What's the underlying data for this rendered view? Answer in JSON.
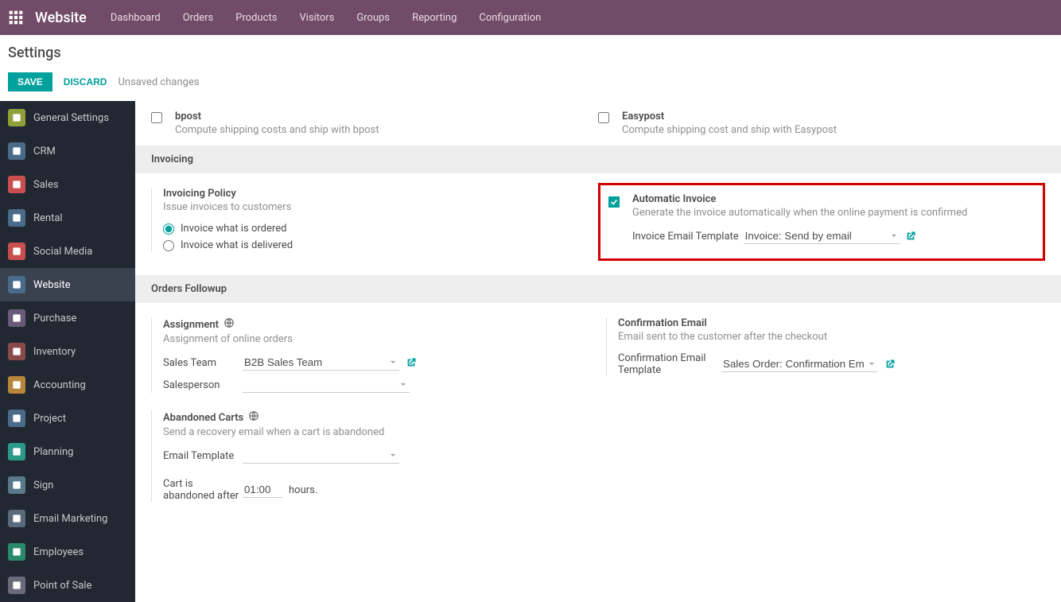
{
  "nav": {
    "brand": "Website",
    "items": [
      "Dashboard",
      "Orders",
      "Products",
      "Visitors",
      "Groups",
      "Reporting",
      "Configuration"
    ]
  },
  "page": {
    "title": "Settings",
    "save": "SAVE",
    "discard": "DISCARD",
    "unsaved": "Unsaved changes"
  },
  "sidebar": {
    "items": [
      {
        "label": "General Settings",
        "color": "#8fa03a"
      },
      {
        "label": "CRM",
        "color": "#4a6b8a"
      },
      {
        "label": "Sales",
        "color": "#c94f4f"
      },
      {
        "label": "Rental",
        "color": "#4a6b8a"
      },
      {
        "label": "Social Media",
        "color": "#c94f4f"
      },
      {
        "label": "Website",
        "color": "#4a6b8a",
        "active": true
      },
      {
        "label": "Purchase",
        "color": "#6b5b7b"
      },
      {
        "label": "Inventory",
        "color": "#8a4a4a"
      },
      {
        "label": "Accounting",
        "color": "#b8863a"
      },
      {
        "label": "Project",
        "color": "#4a6b8a"
      },
      {
        "label": "Planning",
        "color": "#2a9a8a"
      },
      {
        "label": "Sign",
        "color": "#5a7a8a"
      },
      {
        "label": "Email Marketing",
        "color": "#5a6a7a"
      },
      {
        "label": "Employees",
        "color": "#2a8a6a"
      },
      {
        "label": "Point of Sale",
        "color": "#6a6a7a"
      }
    ]
  },
  "shipping": {
    "bpost": {
      "title": "bpost",
      "desc": "Compute shipping costs and ship with bpost"
    },
    "easypost": {
      "title": "Easypost",
      "desc": "Compute shipping cost and ship with Easypost"
    }
  },
  "invoicing": {
    "section": "Invoicing",
    "policy": {
      "title": "Invoicing Policy",
      "desc": "Issue invoices to customers",
      "opt1": "Invoice what is ordered",
      "opt2": "Invoice what is delivered"
    },
    "auto": {
      "title": "Automatic Invoice",
      "desc": "Generate the invoice automatically when the online payment is confirmed",
      "template_label": "Invoice Email Template",
      "template_value": "Invoice: Send by email"
    }
  },
  "followup": {
    "section": "Orders Followup",
    "assignment": {
      "title": "Assignment",
      "desc": "Assignment of online orders",
      "team_label": "Sales Team",
      "team_value": "B2B Sales Team",
      "person_label": "Salesperson"
    },
    "confirmation": {
      "title": "Confirmation Email",
      "desc": "Email sent to the customer after the checkout",
      "template_label": "Confirmation Email Template",
      "template_value": "Sales Order: Confirmation Em"
    },
    "abandoned": {
      "title": "Abandoned Carts",
      "desc": "Send a recovery email when a cart is abandoned",
      "template_label": "Email Template",
      "after_label": "Cart is abandoned after",
      "after_value": "01:00",
      "after_unit": "hours."
    }
  }
}
